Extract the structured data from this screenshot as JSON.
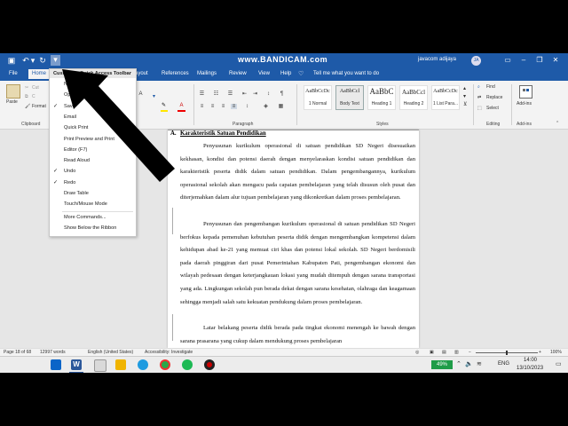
{
  "title_bar": {
    "watermark": "www.BANDICAM.com",
    "user_name": "javacom adijaya",
    "avatar_initials": "JA"
  },
  "tabs": {
    "file": "File",
    "home": "Home",
    "layout_partial": "ayout",
    "references": "References",
    "mailings": "Mailings",
    "review": "Review",
    "view": "View",
    "help": "Help",
    "tell_me": "Tell me what you want to do"
  },
  "ribbon": {
    "paste": "Paste",
    "cut": "Cut",
    "copy": "C",
    "format": "Format",
    "clipboard": "Clipboard",
    "paragraph": "Paragraph",
    "styles": "Styles",
    "find": "Find",
    "replace": "Replace",
    "select": "Select",
    "editing": "Editing",
    "addins": "Add-ins",
    "addins_group": "Add-ins",
    "style_items": [
      {
        "preview": "AaBbCcDc",
        "name": "1 Normal"
      },
      {
        "preview": "AaBbCcl",
        "name": "Body Text"
      },
      {
        "preview": "AaBbC",
        "name": "Heading 1"
      },
      {
        "preview": "AaBbCcl",
        "name": "Heading 2"
      },
      {
        "preview": "AaBbCcDc",
        "name": "1 List Para..."
      }
    ]
  },
  "qat_menu": {
    "title": "Customize Quick Access Toolbar",
    "items": [
      {
        "label": "Ne",
        "checked": false
      },
      {
        "label": "Op",
        "checked": false
      },
      {
        "label": "Save",
        "checked": true
      },
      {
        "label": "Email",
        "checked": false
      },
      {
        "label": "Quick Print",
        "checked": false
      },
      {
        "label": "Print Preview and Print",
        "checked": false
      },
      {
        "label": "Editor (F7)",
        "checked": false
      },
      {
        "label": "Read Aloud",
        "checked": false
      },
      {
        "label": "Undo",
        "checked": true
      },
      {
        "label": "Redo",
        "checked": true
      },
      {
        "label": "Draw Table",
        "checked": false
      },
      {
        "label": "Touch/Mouse Mode",
        "checked": false
      },
      {
        "label": "More Commands...",
        "checked": false
      },
      {
        "label": "Show Below the Ribbon",
        "checked": false
      }
    ]
  },
  "document": {
    "heading_letter": "A.",
    "heading_text": "Karakteristik Satuan Pendidikan",
    "para1": "Penyusunan kurikulum operasional di satuan pendidikan SD Negeri disesuaikan kekhasan, kondisi dan potensi daerah dengan menyelaraskan kondisi satuan pendidikan dan karakteristik peserta didik dalam satuan pendidikan. Dalam pengembangannya, kurikulum operasional sekolah akan mengacu pada capaian pembelajaran yang telah disusun oleh pusat dan diterjemahkan dalam alur tujuan pembelajaran yang dikonkretkan dalam proses pembelajaran.",
    "para2": "Penyusunan dan pengembangan kurikulum operasional di satuan pendidikan SD Negeri berfokus kepada pemenuhan kebutuhan peserta didik dengan mengembangkan kompetensi dalam kehidupan abad ke-21 yang memuat ciri khas dan potensi lokal sekolah. SD Negeri berdomisili pada daerah pinggiran dari pusat Pemerintahan Kabupaten Pati, pengembangan ekonomi dan wilayah pedesaan dengan keterjangkauan lokasi yang mudah ditempuh dengan sarana transportasi yang ada. Lingkungan sekolah pun berada dekat dengan sarana kesehatan, olahraga dan keagamaan sehingga menjadi salah satu kekuatan pendukung dalam proses pembelajaran.",
    "para3": "Latar belakang peserta didik berada pada tingkat ekonomi menengah ke bawah dengan sarana prasarana yang cukup dalam mendukung proses pembelajaran"
  },
  "status_bar": {
    "page": "Page 18 of 68",
    "words": "12997 words",
    "language": "English (United States)",
    "accessibility": "Accessibility: Investigate",
    "zoom": "100%"
  },
  "taskbar": {
    "battery": "49%",
    "lang": "ENG",
    "time": "14:00",
    "date": "13/10/2023"
  },
  "colors": {
    "word_blue": "#1e5aa8",
    "ribbon_bg": "#f3f3f3"
  }
}
